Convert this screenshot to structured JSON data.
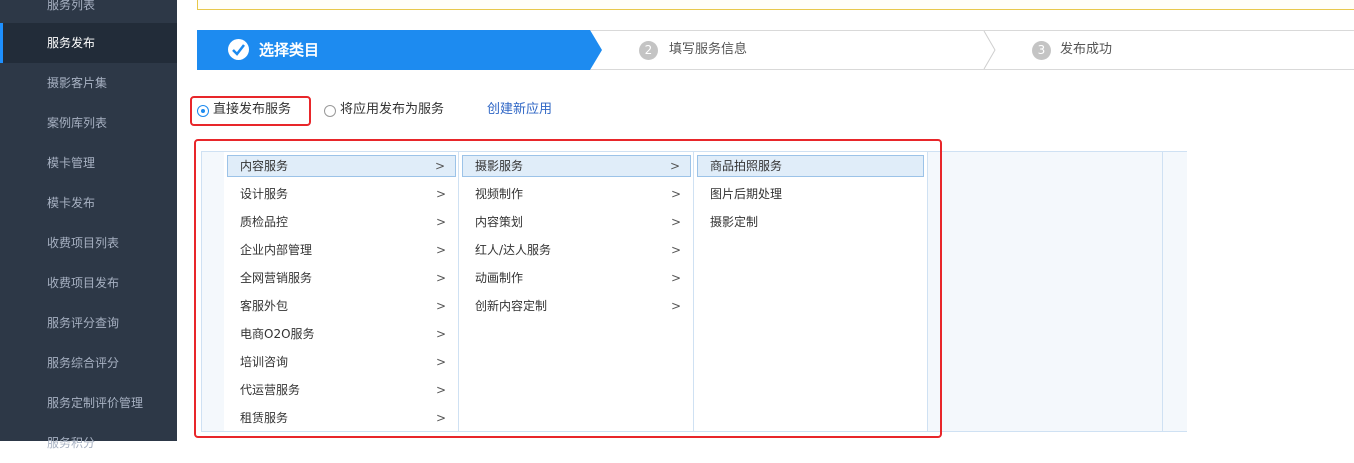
{
  "sidebar": {
    "items": [
      {
        "label": "服务列表",
        "active": false
      },
      {
        "label": "服务发布",
        "active": true
      },
      {
        "label": "摄影客片集",
        "active": false
      },
      {
        "label": "案例库列表",
        "active": false
      },
      {
        "label": "模卡管理",
        "active": false
      },
      {
        "label": "模卡发布",
        "active": false
      },
      {
        "label": "收费项目列表",
        "active": false
      },
      {
        "label": "收费项目发布",
        "active": false
      },
      {
        "label": "服务评分查询",
        "active": false
      },
      {
        "label": "服务综合评分",
        "active": false
      },
      {
        "label": "服务定制评价管理",
        "active": false
      },
      {
        "label": "服务积分",
        "active": false
      }
    ]
  },
  "steps": [
    {
      "num": "✓",
      "label": "选择类目",
      "state": "current"
    },
    {
      "num": "2",
      "label": "填写服务信息",
      "state": "todo"
    },
    {
      "num": "3",
      "label": "发布成功",
      "state": "todo"
    }
  ],
  "publish_options": {
    "direct": {
      "label": "直接发布服务",
      "selected": true
    },
    "app": {
      "label": "将应用发布为服务",
      "selected": false
    },
    "create_link": "创建新应用"
  },
  "categories": {
    "level1": [
      "内容服务",
      "设计服务",
      "质检品控",
      "企业内部管理",
      "全网营销服务",
      "客服外包",
      "电商O2O服务",
      "培训咨询",
      "代运营服务",
      "租赁服务"
    ],
    "level1_selected": 0,
    "level2": [
      "摄影服务",
      "视频制作",
      "内容策划",
      "红人/达人服务",
      "动画制作",
      "创新内容定制"
    ],
    "level2_selected": 0,
    "level3": [
      "商品拍照服务",
      "图片后期处理",
      "摄影定制"
    ],
    "level3_selected": 0,
    "arrow_glyph": ">"
  },
  "colors": {
    "sidebar_bg": "#2d3847",
    "accent": "#1d8bf0",
    "highlight_red": "#e8262a",
    "link": "#2f66c5"
  }
}
